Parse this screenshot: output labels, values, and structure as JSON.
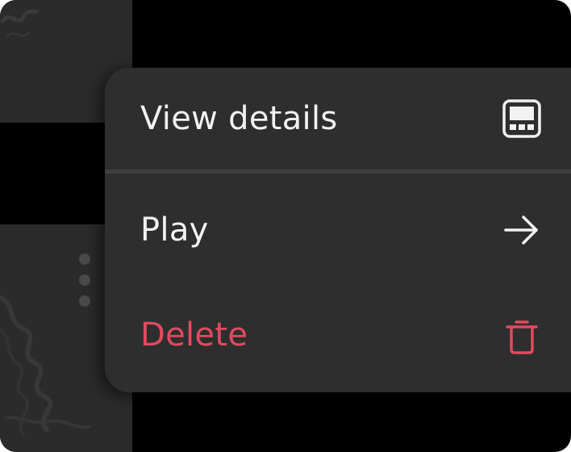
{
  "menu": {
    "items": [
      {
        "label": "View details",
        "icon": "details-panel-icon"
      },
      {
        "label": "Play",
        "icon": "arrow-right-icon"
      },
      {
        "label": "Delete",
        "icon": "trash-icon"
      }
    ]
  },
  "colors": {
    "menu_background": "#2e2e2e",
    "text": "#f2f2f2",
    "danger": "#e24a5e",
    "backdrop": "#000000"
  }
}
